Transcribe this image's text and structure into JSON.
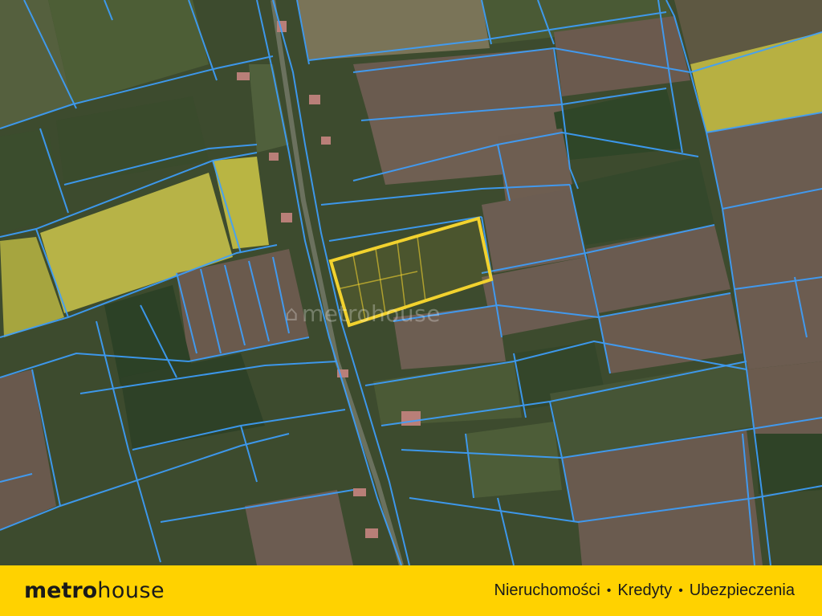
{
  "map": {
    "parcel_line_color": "#3da0ff",
    "highlight_color": "#f2d22e"
  },
  "watermark": {
    "brand_text": "metrohouse"
  },
  "footer": {
    "logo_text_bold": "metro",
    "logo_text_light": "house",
    "tagline": [
      "Nieruchomości",
      "Kredyty",
      "Ubezpieczenia"
    ],
    "separator": "•",
    "background_color": "#ffd200"
  }
}
